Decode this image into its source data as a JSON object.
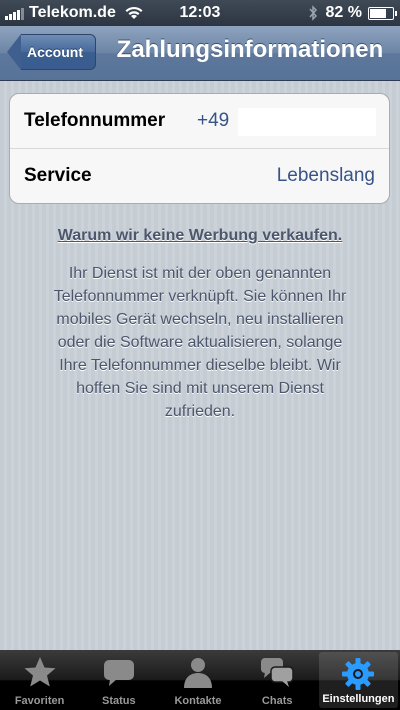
{
  "status_bar": {
    "carrier": "Telekom.de",
    "time": "12:03",
    "battery": "82 %",
    "battery_level": 0.82
  },
  "nav": {
    "back_label": "Account",
    "title": "Zahlungsinformationen"
  },
  "info_rows": [
    {
      "label": "Telefonnummer",
      "value": "+49"
    },
    {
      "label": "Service",
      "value": "Lebenslang"
    }
  ],
  "note": {
    "heading": "Warum wir keine Werbung verkaufen.",
    "lines": [
      "Ihr Dienst ist mit der oben genannten",
      "Telefonnummer verknüpft. Sie können Ihr",
      "mobiles Gerät wechseln, neu installieren",
      "oder die Software aktualisieren, solange",
      "Ihre Telefonnummer dieselbe bleibt. Wir",
      "hoffen Sie sind mit unserem Dienst",
      "zufrieden."
    ]
  },
  "tabs": [
    {
      "label": "Favoriten",
      "icon": "star-icon",
      "active": false
    },
    {
      "label": "Status",
      "icon": "speech-bubble-icon",
      "active": false
    },
    {
      "label": "Kontakte",
      "icon": "person-icon",
      "active": false
    },
    {
      "label": "Chats",
      "icon": "chat-bubbles-icon",
      "active": false
    },
    {
      "label": "Einstellungen",
      "icon": "gear-icon",
      "active": true
    }
  ],
  "colors": {
    "nav_blue": "#6c85a6",
    "value_blue": "#385487",
    "active_tab": "#1a8cff"
  }
}
